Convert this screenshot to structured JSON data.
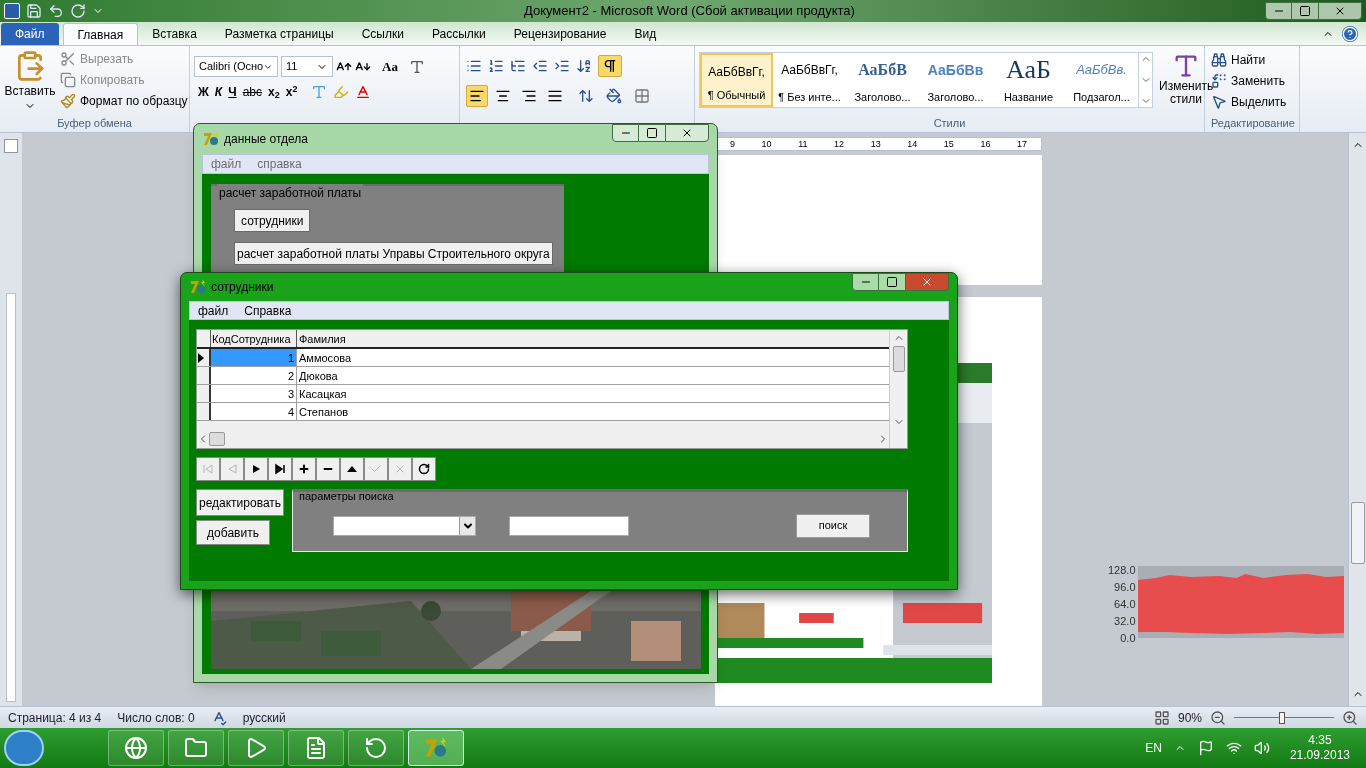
{
  "word": {
    "title": "Документ2 - Microsoft Word (Сбой активации продукта)",
    "tabs": [
      {
        "label": "Файл",
        "kind": "file",
        "selected": false
      },
      {
        "label": "Главная",
        "kind": "tab",
        "selected": true
      },
      {
        "label": "Вставка",
        "kind": "tab",
        "selected": false
      },
      {
        "label": "Разметка страницы",
        "kind": "tab",
        "selected": false
      },
      {
        "label": "Ссылки",
        "kind": "tab",
        "selected": false
      },
      {
        "label": "Рассылки",
        "kind": "tab",
        "selected": false
      },
      {
        "label": "Рецензирование",
        "kind": "tab",
        "selected": false
      },
      {
        "label": "Вид",
        "kind": "tab",
        "selected": false
      }
    ],
    "clipboard": {
      "paste": "Вставить",
      "cut": "Вырезать",
      "copy": "Копировать",
      "format_painter": "Формат по образцу",
      "label": "Буфер обмена"
    },
    "font": {
      "name": "Calibri (Осно",
      "size": "11",
      "case": "Aa",
      "format_buttons": [
        {
          "label": "Ж",
          "kind": "bold"
        },
        {
          "label": "К",
          "kind": "italic"
        },
        {
          "label": "Ч",
          "kind": "underline"
        },
        {
          "label": "abc",
          "kind": "strike"
        },
        {
          "label": "x$_{2}$",
          "kind": "sub"
        },
        {
          "label": "x$^{2}$",
          "kind": "sup"
        }
      ]
    },
    "paragraph": {
      "show_formatting_marks": true,
      "alignment_buttons": [
        {
          "kind": "left",
          "selected": true
        },
        {
          "kind": "center",
          "selected": false
        },
        {
          "kind": "right",
          "selected": false
        },
        {
          "kind": "justify",
          "selected": false
        }
      ]
    },
    "styles": [
      {
        "sample": "АаБбВвГг,",
        "name": "¶ Обычный",
        "kind": "normal",
        "selected": true
      },
      {
        "sample": "АаБбВвГг,",
        "name": "¶ Без инте...",
        "kind": "normal",
        "selected": false
      },
      {
        "sample": "АаБбВ",
        "name": "Заголово...",
        "kind": "heading1",
        "selected": false
      },
      {
        "sample": "АаБбВв",
        "name": "Заголово...",
        "kind": "heading2",
        "selected": false
      },
      {
        "sample": "АаБ",
        "name": "Название",
        "kind": "title",
        "selected": false
      },
      {
        "sample": "АаБбВв.",
        "name": "Подзагол...",
        "kind": "subtitle",
        "selected": false
      }
    ],
    "styles_label": "Стили",
    "change_styles": "Изменить стили",
    "editing": {
      "find": "Найти",
      "replace": "Заменить",
      "select": "Выделить",
      "label": "Редактирование"
    },
    "ruler_numbers": [
      "9",
      "10",
      "11",
      "12",
      "13",
      "14",
      "15",
      "16",
      "17"
    ],
    "graph_ticks": [
      "128.0",
      "96.0",
      "64.0",
      "32.0",
      "0.0"
    ],
    "status": {
      "page": "Страница: 4 из 4",
      "words": "Число слов: 0",
      "language": "русский",
      "zoom": "90%",
      "zoom_level": {
        "level": 0.48
      }
    }
  },
  "dept_window": {
    "title": "данные отдела",
    "active": false,
    "menu": [
      "файл",
      "справка"
    ],
    "group_title": "расчет заработной платы",
    "buttons": [
      "сотрудники",
      "расчет заработной платы Управы Строительного округа"
    ]
  },
  "emp_window": {
    "title": "сотрудники",
    "active": true,
    "menu": [
      "файл",
      "Справка"
    ],
    "columns": [
      "КодСотрудника",
      "Фамилия"
    ],
    "rows": [
      {
        "id": "1",
        "surname": "Аммосова",
        "selected": true
      },
      {
        "id": "2",
        "surname": "Дюкова",
        "selected": false
      },
      {
        "id": "3",
        "surname": "Касацкая",
        "selected": false
      },
      {
        "id": "4",
        "surname": "Степанов",
        "selected": false
      }
    ],
    "navigator": [
      {
        "kind": "first",
        "disabled": true
      },
      {
        "kind": "prior",
        "disabled": true
      },
      {
        "kind": "next",
        "disabled": false
      },
      {
        "kind": "last",
        "disabled": false
      },
      {
        "kind": "insert",
        "disabled": false
      },
      {
        "kind": "delete",
        "disabled": false
      },
      {
        "kind": "edit",
        "disabled": false
      },
      {
        "kind": "post",
        "disabled": true
      },
      {
        "kind": "cancel",
        "disabled": true
      },
      {
        "kind": "refresh",
        "disabled": false
      }
    ],
    "edit_button": "редактировать",
    "add_button": "добавить",
    "search_group": "параметры поиска",
    "search_button": "поиск"
  },
  "taskbar": {
    "apps": [
      {
        "kind": "browser",
        "active": false
      },
      {
        "kind": "folder",
        "active": false
      },
      {
        "kind": "media",
        "active": false
      },
      {
        "kind": "word",
        "active": false
      },
      {
        "kind": "torrent",
        "active": false
      },
      {
        "kind": "delphi",
        "active": true
      }
    ],
    "language": "EN",
    "time": "4:35",
    "date": "21.09.2013"
  }
}
